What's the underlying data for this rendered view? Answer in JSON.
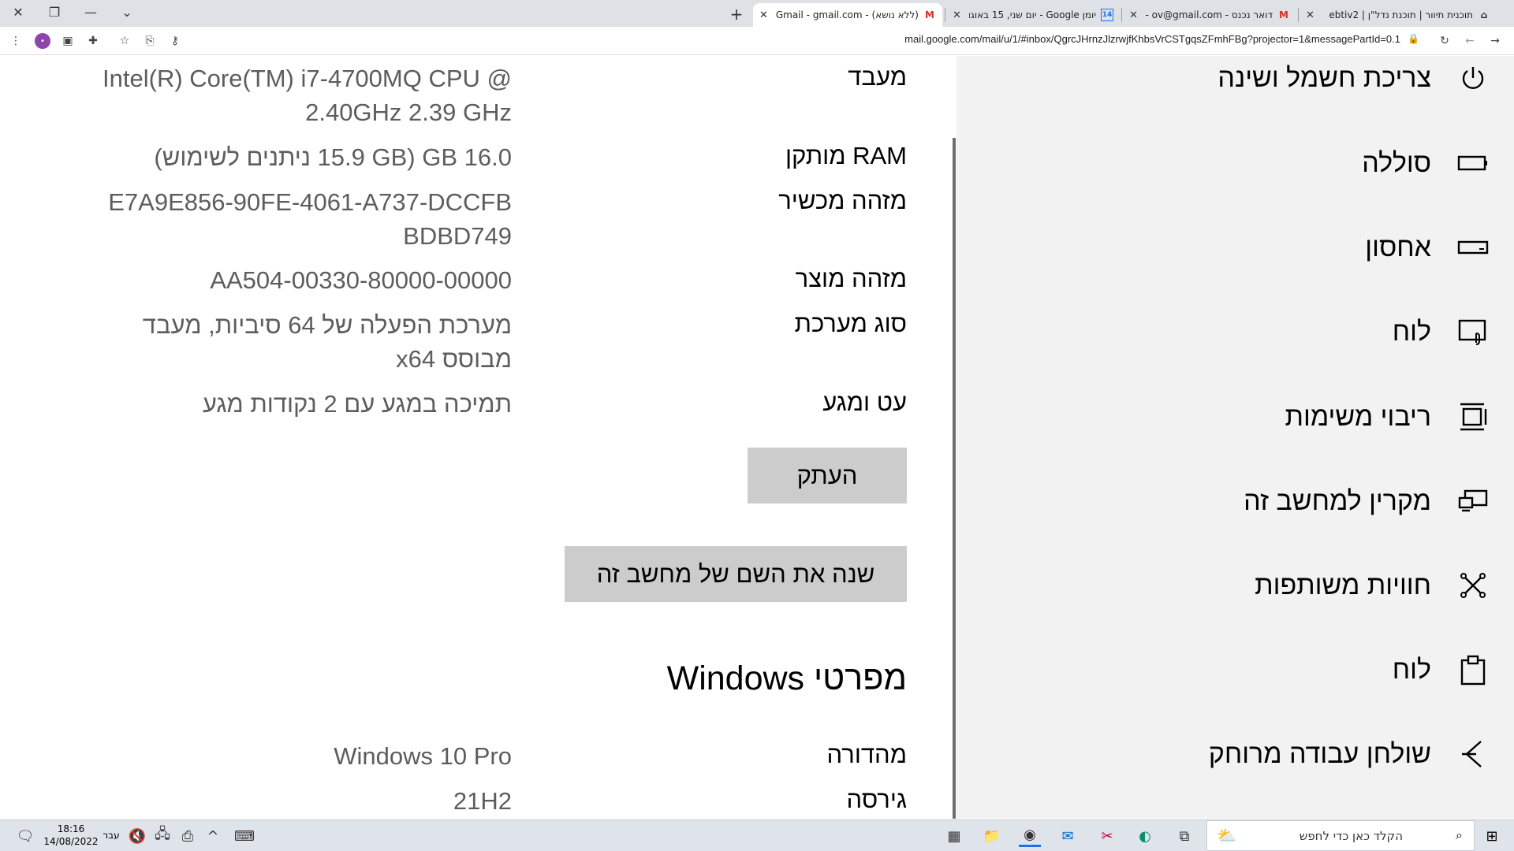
{
  "browser": {
    "tabs": [
      {
        "title": "תוכנית תיוור | תוכנת נדל\"ן | ebtiv2",
        "icon": "home-icon"
      },
      {
        "title": "דואר נכנס - Gmail - ov@gmail.com",
        "icon": "gmail-icon"
      },
      {
        "title": "יומן Google - יום שני, 15 באוגוסט",
        "icon": "calendar-icon",
        "icon_text": "14"
      },
      {
        "title": "(ללא נושא) - Gmail - gmail.com@",
        "icon": "gmail-icon"
      }
    ],
    "url": "mail.google.com/mail/u/1/#inbox/QgrcJHrnzJlzrwjfKhbsVrCSTgqsZFmhFBg?projector=1&messagePartId=0.1"
  },
  "specs": [
    {
      "label": "מעבד",
      "value": "Intel(R) Core(TM) i7-4700MQ CPU @ 2.40GHz   2.39 GHz"
    },
    {
      "label": "RAM מותקן",
      "value": "16.0 GB (15.9 GB ניתנים לשימוש)"
    },
    {
      "label": "מזהה מכשיר",
      "value": "E7A9E856-90FE-4061-A737-DCCFBBDBD749"
    },
    {
      "label": "מזהה מוצר",
      "value": "00330-80000-00000-AA504"
    },
    {
      "label": "סוג מערכת",
      "value": "מערכת הפעלה של 64 סיביות, מעבד מבוסס x64"
    },
    {
      "label": "עט ומגע",
      "value": "תמיכה במגע עם 2 נקודות מגע"
    }
  ],
  "buttons": {
    "copy": "העתק",
    "rename": "שנה את השם של מחשב זה"
  },
  "windows_section": {
    "title": "מפרטי Windows",
    "rows": [
      {
        "label": "מהדורה",
        "value": "Windows 10 Pro"
      },
      {
        "label": "גירסה",
        "value": "21H2"
      }
    ]
  },
  "nav": {
    "items": [
      {
        "label": "צריכת חשמל ושינה",
        "icon": "power-icon"
      },
      {
        "label": "סוללה",
        "icon": "battery-icon"
      },
      {
        "label": "אחסון",
        "icon": "storage-icon"
      },
      {
        "label": "לוח",
        "icon": "tablet-icon"
      },
      {
        "label": "ריבוי משימות",
        "icon": "multitasking-icon"
      },
      {
        "label": "מקרין למחשב זה",
        "icon": "projecting-icon"
      },
      {
        "label": "חוויות משותפות",
        "icon": "shared-experiences-icon"
      },
      {
        "label": "לוח",
        "icon": "clipboard-icon"
      },
      {
        "label": "שולחן עבודה מרוחק",
        "icon": "remote-desktop-icon"
      }
    ]
  },
  "taskbar": {
    "search_placeholder": "הקלד כאן כדי לחפש",
    "time": "18:16",
    "date": "14/08/2022",
    "language": "עבר"
  }
}
